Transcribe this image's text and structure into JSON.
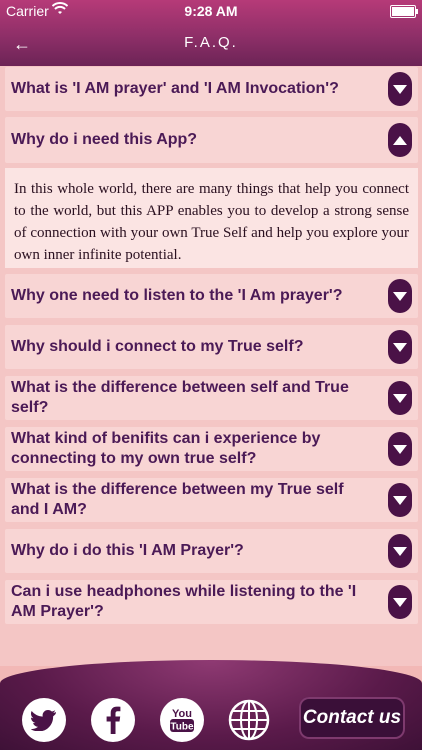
{
  "status_bar": {
    "carrier": "Carrier",
    "time": "9:28 AM"
  },
  "header": {
    "title": "F.A.Q."
  },
  "faq": [
    {
      "question": "What is 'I AM prayer' and 'I AM Invocation'?",
      "expanded": false
    },
    {
      "question": "Why do i need this App?",
      "expanded": true,
      "answer": "In this whole world, there are many things that help you connect to the world, but this APP enables you to develop a strong sense of connection with your own True Self and help you explore your own inner infinite potential."
    },
    {
      "question": "Why one need to listen to the 'I Am prayer'?",
      "expanded": false
    },
    {
      "question": "Why should i connect to my True self?",
      "expanded": false
    },
    {
      "question": "What is the difference between self and True self?",
      "expanded": false
    },
    {
      "question": "What kind of benifits can i experience by connecting to my own true self?",
      "expanded": false
    },
    {
      "question": "What is the difference between my True self and I AM?",
      "expanded": false
    },
    {
      "question": "Why do i do this 'I AM Prayer'?",
      "expanded": false
    },
    {
      "question": "Can i use headphones while listening to the 'I AM Prayer'?",
      "expanded": false
    }
  ],
  "footer": {
    "contact_label": "Contact us",
    "social": [
      "twitter-icon",
      "facebook-icon",
      "youtube-icon",
      "globe-icon"
    ]
  },
  "colors": {
    "header_start": "#b63a78",
    "header_end": "#6c2456",
    "background": "#f4c6c5",
    "item_bg": "#f8d5d4",
    "answer_bg": "#fbe4e3",
    "question_text": "#4b1a56",
    "toggle_bg": "#4a1247"
  }
}
